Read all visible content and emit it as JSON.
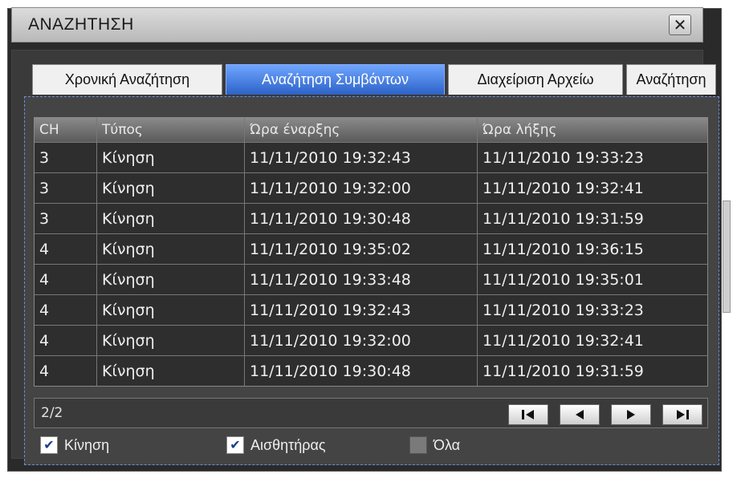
{
  "window": {
    "title": "ΑΝΑΖΗΤΗΣΗ",
    "close_glyph": "✕"
  },
  "tabs": [
    {
      "label": "Χρονική Αναζήτηση",
      "active": false
    },
    {
      "label": "Αναζήτηση Συμβάντων",
      "active": true
    },
    {
      "label": "Διαχείριση Αρχείω",
      "active": false
    },
    {
      "label": "Αναζήτηση",
      "active": false
    }
  ],
  "table": {
    "headers": [
      "CH",
      "Τύπος",
      "Ώρα έναρξης",
      "Ώρα λήξης"
    ],
    "rows": [
      [
        "3",
        "Κίνηση",
        "11/11/2010 19:32:43",
        "11/11/2010 19:33:23"
      ],
      [
        "3",
        "Κίνηση",
        "11/11/2010 19:32:00",
        "11/11/2010 19:32:41"
      ],
      [
        "3",
        "Κίνηση",
        "11/11/2010 19:30:48",
        "11/11/2010 19:31:59"
      ],
      [
        "4",
        "Κίνηση",
        "11/11/2010 19:35:02",
        "11/11/2010 19:36:15"
      ],
      [
        "4",
        "Κίνηση",
        "11/11/2010 19:33:48",
        "11/11/2010 19:35:01"
      ],
      [
        "4",
        "Κίνηση",
        "11/11/2010 19:32:43",
        "11/11/2010 19:33:23"
      ],
      [
        "4",
        "Κίνηση",
        "11/11/2010 19:32:00",
        "11/11/2010 19:32:41"
      ],
      [
        "4",
        "Κίνηση",
        "11/11/2010 19:30:48",
        "11/11/2010 19:31:59"
      ]
    ]
  },
  "pagination": {
    "page": "2/2",
    "buttons": [
      "first-page-icon",
      "prev-page-icon",
      "next-page-icon",
      "last-page-icon"
    ]
  },
  "filters": [
    {
      "label": "Κίνηση",
      "checked": true
    },
    {
      "label": "Αισθητήρας",
      "checked": true
    },
    {
      "label": "Όλα",
      "checked": false
    }
  ],
  "colors": {
    "active_tab": "#3a73e0",
    "window_bg": "#2a2a2a"
  }
}
